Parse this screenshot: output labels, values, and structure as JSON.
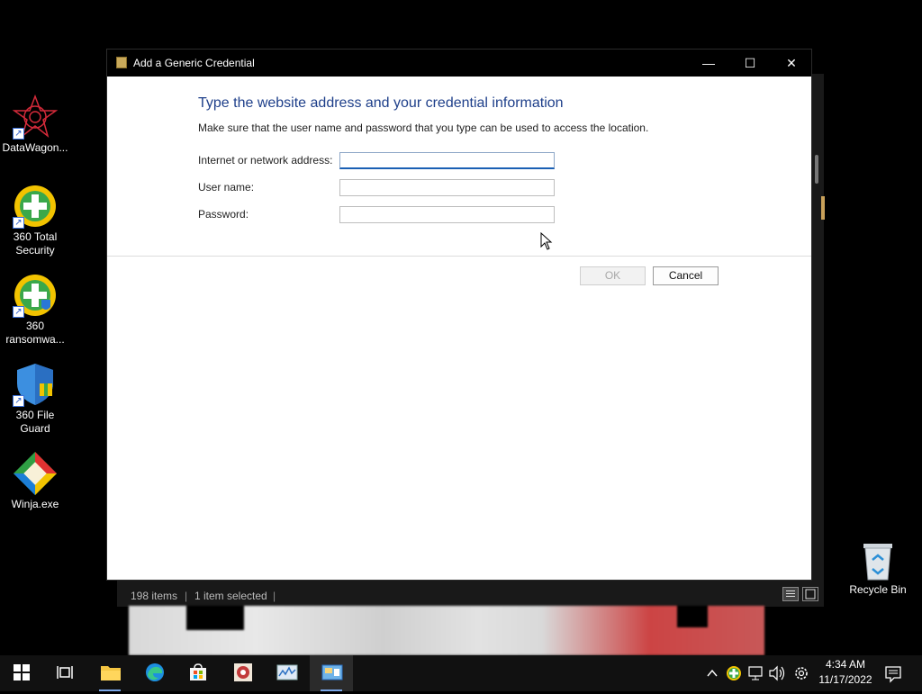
{
  "desktop": {
    "icons": [
      {
        "label": "DataWagon..."
      },
      {
        "label": "360 Total Security"
      },
      {
        "label": "360 ransomwa..."
      },
      {
        "label": "360 File Guard"
      },
      {
        "label": "Winja.exe"
      },
      {
        "label": "Recycle Bin"
      }
    ]
  },
  "explorer": {
    "status_items": "198 items",
    "status_selected": "1 item selected"
  },
  "dialog": {
    "title": "Add a Generic Credential",
    "heading": "Type the website address and your credential information",
    "description": "Make sure that the user name and password that you type can be used to access the location.",
    "fields": [
      {
        "label": "Internet or network address:",
        "value": ""
      },
      {
        "label": "User name:",
        "value": ""
      },
      {
        "label": "Password:",
        "value": ""
      }
    ],
    "ok_label": "OK",
    "cancel_label": "Cancel",
    "minimize_glyph": "—",
    "maximize_glyph": "☐",
    "close_glyph": "✕"
  },
  "taskbar": {
    "items": [
      "start-icon",
      "task-view-icon",
      "file-explorer-icon",
      "edge-icon",
      "store-icon",
      "app-icon",
      "performance-icon",
      "credential-manager-icon"
    ],
    "clock_time": "4:34 AM",
    "clock_date": "11/17/2022"
  },
  "colors": {
    "heading": "#1e3f8a",
    "taskbar": "#111111",
    "focus_underline": "#1a5fb4"
  }
}
